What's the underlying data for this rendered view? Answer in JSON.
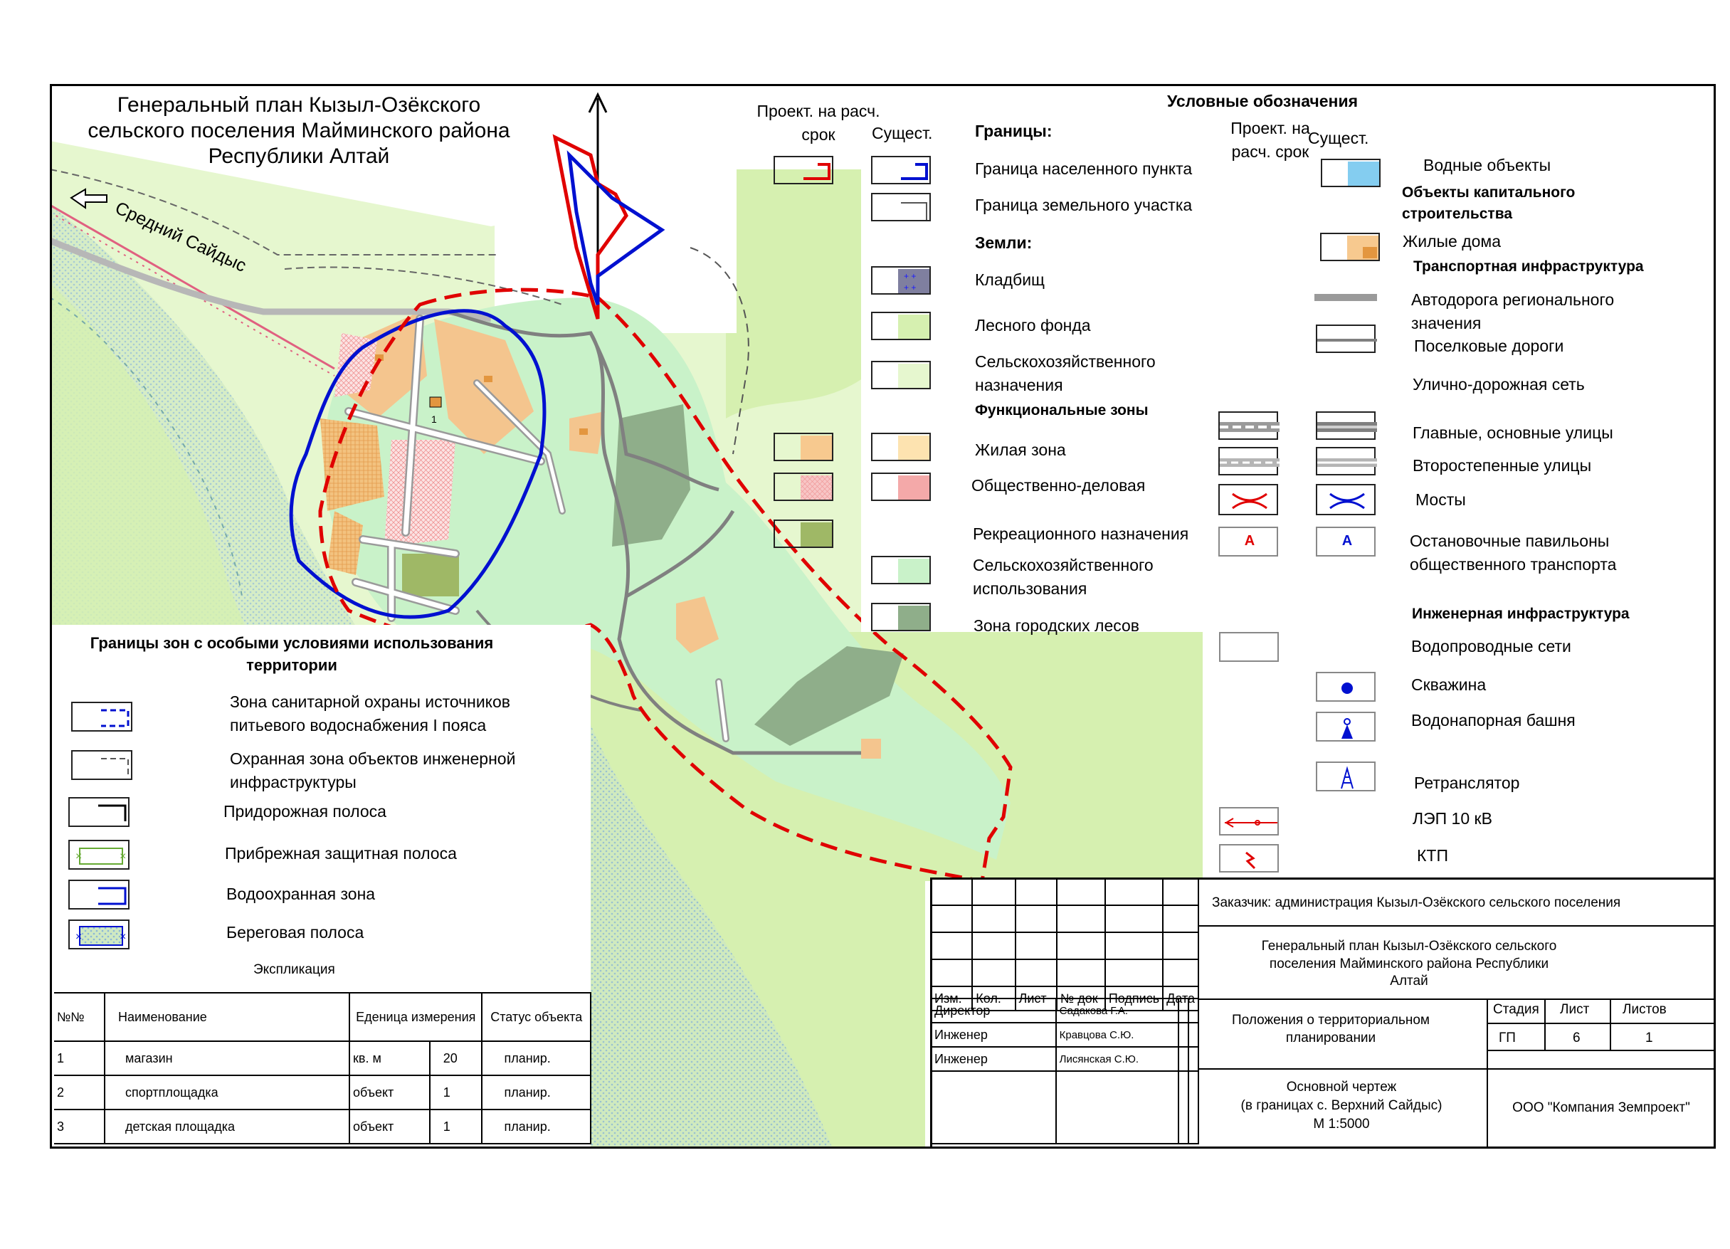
{
  "map": {
    "title": "Генеральный план  Кызыл-Озёкского сельского поселения Майминского района Республики Алтай",
    "road_label": "Средний Сайдыс",
    "feature_numbers": [
      "1"
    ]
  },
  "legend": {
    "header": "Условные обозначения",
    "col_proj": "Проект. на расч. срок",
    "col_exist": "Сущест.",
    "col_proj_right": "Проект. на расч. срок",
    "col_exist_right": "Сущест.",
    "left_sections": [
      {
        "title": "Границы:",
        "items": [
          "Граница населенного пункта",
          "Граница земельного участка"
        ]
      },
      {
        "title": "Земли:",
        "items": [
          "Кладбищ",
          "Лесного фонда",
          "Сельскохозяйственного назначения"
        ]
      },
      {
        "title": "Функциональные зоны",
        "items": [
          "Жилая зона",
          "Общественно-деловая",
          "Рекреационного назначения",
          "Сельскохозяйственного использования",
          "Зона городских лесов"
        ]
      }
    ],
    "right": {
      "water": "Водные объекты",
      "capital_title": "Объекты капитального строительства",
      "houses": "Жилые дома",
      "transport_title": "Транспортная инфраструктура",
      "road_regional": "Автодорога регионального значения",
      "road_settlement": "Поселковые дороги",
      "street_network": "Улично-дорожная сеть",
      "main_streets": "Главные, основные улицы",
      "secondary_streets": "Второстепенные улицы",
      "bridges": "Мосты",
      "stops": "Остановочные павильоны общественного транспорта",
      "stop_symbol": "А",
      "engineering_title": "Инженерная инфраструктура",
      "water_pipes": "Водопроводные сети",
      "well": "Скважина",
      "water_tower": "Водонапорная башня",
      "repeater": "Ретранслятор",
      "power_line": "ЛЭП 10 кВ",
      "ktp": "КТП"
    }
  },
  "zones": {
    "title": "Границы зон с особыми условиями использования территории",
    "items": [
      "Зона санитарной охраны источников питьевого водоснабжения I пояса",
      "Охранная зона объектов инженерной инфраструктуры",
      "Придорожная полоса",
      "Прибрежная защитная полоса",
      "Водоохранная зона",
      "Береговая полоса"
    ]
  },
  "explication": {
    "title": "Экспликация",
    "headers": [
      "№№",
      "Наименование",
      "Еденица измерения",
      "Статус объекта"
    ],
    "rows": [
      {
        "n": "1",
        "name": "магазин",
        "unit": "кв. м",
        "qty": "20",
        "status": "планир."
      },
      {
        "n": "2",
        "name": "спортплощадка",
        "unit": "объект",
        "qty": "1",
        "status": "планир."
      },
      {
        "n": "3",
        "name": "детская площадка",
        "unit": "объект",
        "qty": "1",
        "status": "планир."
      }
    ]
  },
  "stamp": {
    "client": "Заказчик: администрация Кызыл-Озёкского сельского поселения",
    "plan_title": "Генеральный план  Кызыл-Озёкского сельского поселения Майминского района Республики Алтай",
    "cols": [
      "Изм.",
      "Кол.",
      "Лист",
      "№ док",
      "Подпись",
      "Дата"
    ],
    "people": [
      {
        "role": "Директор",
        "name": "Садакова Г.А."
      },
      {
        "role": "Инженер",
        "name": "Кравцова С.Ю."
      },
      {
        "role": "Инженер",
        "name": "Лисянская С.Ю."
      }
    ],
    "section": "Положения о территориальном планировании",
    "stage_h": "Стадия",
    "sheet_h": "Лист",
    "sheets_h": "Листов",
    "stage": "ГП",
    "sheet": "6",
    "sheets": "1",
    "drawing": "Основной чертеж",
    "drawing_bounds": "(в границах с. Верхний Сайдыс)",
    "scale": "М 1:5000",
    "company": "ООО \"Компания Земпроект\""
  },
  "colors": {
    "border_proj": "#e00000",
    "border_exist": "#0010d0",
    "forest": "#d6f0b0",
    "agri": "#e6f7cf",
    "agri_use": "#c9f2c9",
    "urban_forest": "#8fae8a",
    "residential": "#f7c98f",
    "public": "#f4a9a9",
    "water": "#84cdf0",
    "recreation": "#9fb866"
  }
}
